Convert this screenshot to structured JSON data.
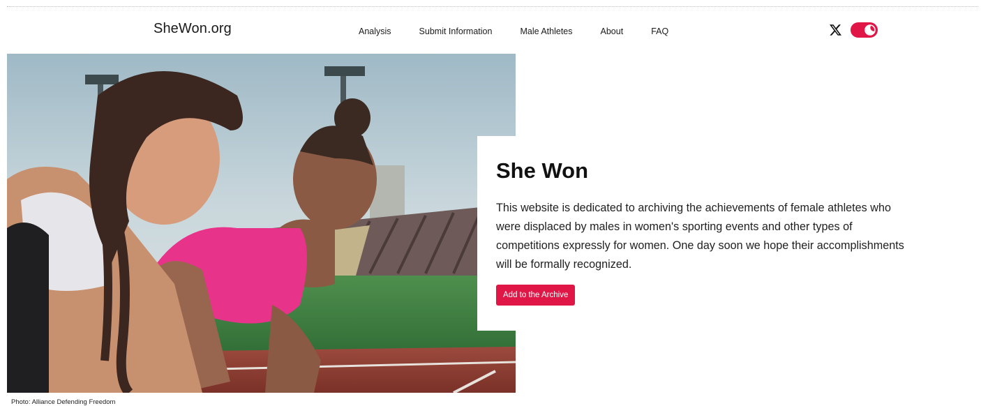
{
  "site": {
    "logo": "SheWon.org"
  },
  "nav": {
    "items": [
      {
        "label": "Analysis"
      },
      {
        "label": "Submit Information"
      },
      {
        "label": "Male Athletes"
      },
      {
        "label": "About"
      },
      {
        "label": "FAQ"
      }
    ]
  },
  "header_icons": {
    "social": "x-logo-icon",
    "theme_toggle": "dark-mode-toggle"
  },
  "hero": {
    "photo_credit": "Photo: Alliance Defending Freedom",
    "title": "She Won",
    "description": "This website is dedicated to archiving the achievements of female athletes who were displaced by males in women's sporting events and other types of competitions expressly for women. One day soon we hope their accomplishments will be formally recognized.",
    "cta_label": "Add to the Archive"
  },
  "colors": {
    "accent": "#e01746",
    "text": "#111111",
    "background": "#ffffff"
  }
}
